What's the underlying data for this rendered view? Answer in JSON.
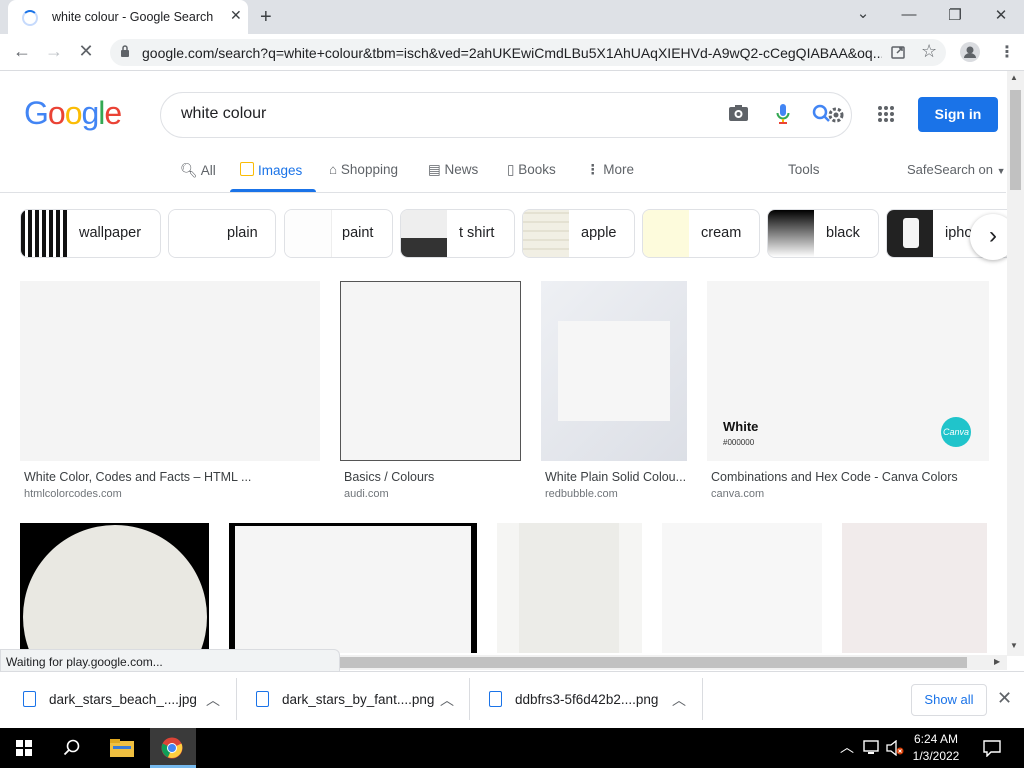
{
  "browser": {
    "tab_title": "white colour - Google Search",
    "url": "google.com/search?q=white+colour&tbm=isch&ved=2ahUKEwiCmdLBu5X1AhUAqXIEHVd-A9wQ2-cCegQIABAA&oq..."
  },
  "google": {
    "logo_text": "Google",
    "query": "white colour",
    "signin_label": "Sign in",
    "tabs": [
      {
        "label": "All"
      },
      {
        "label": "Images"
      },
      {
        "label": "Shopping"
      },
      {
        "label": "News"
      },
      {
        "label": "Books"
      },
      {
        "label": "More"
      }
    ],
    "tools_label": "Tools",
    "safesearch_label": "SafeSearch on"
  },
  "chips": [
    {
      "label": "wallpaper"
    },
    {
      "label": "plain"
    },
    {
      "label": "paint"
    },
    {
      "label": "t shirt"
    },
    {
      "label": "apple"
    },
    {
      "label": "cream"
    },
    {
      "label": "black"
    },
    {
      "label": "iphone"
    }
  ],
  "results": [
    {
      "title": "White Color, Codes and Facts – HTML ...",
      "source": "htmlcolorcodes.com"
    },
    {
      "title": "Basics / Colours",
      "source": "audi.com"
    },
    {
      "title": "White Plain Solid Colou...",
      "source": "redbubble.com"
    },
    {
      "title": "Combinations and Hex Code - Canva Colors",
      "source": "canva.com",
      "overlay_name": "White",
      "overlay_hex": "#000000",
      "overlay_brand": "Canva"
    }
  ],
  "status_text": "Waiting for play.google.com...",
  "downloads": [
    {
      "name": "dark_stars_beach_....jpg"
    },
    {
      "name": "dark_stars_by_fant....png"
    },
    {
      "name": "ddbfrs3-5f6d42b2....png"
    }
  ],
  "show_all_label": "Show all",
  "taskbar": {
    "time": "6:24 AM",
    "date": "1/3/2022"
  }
}
